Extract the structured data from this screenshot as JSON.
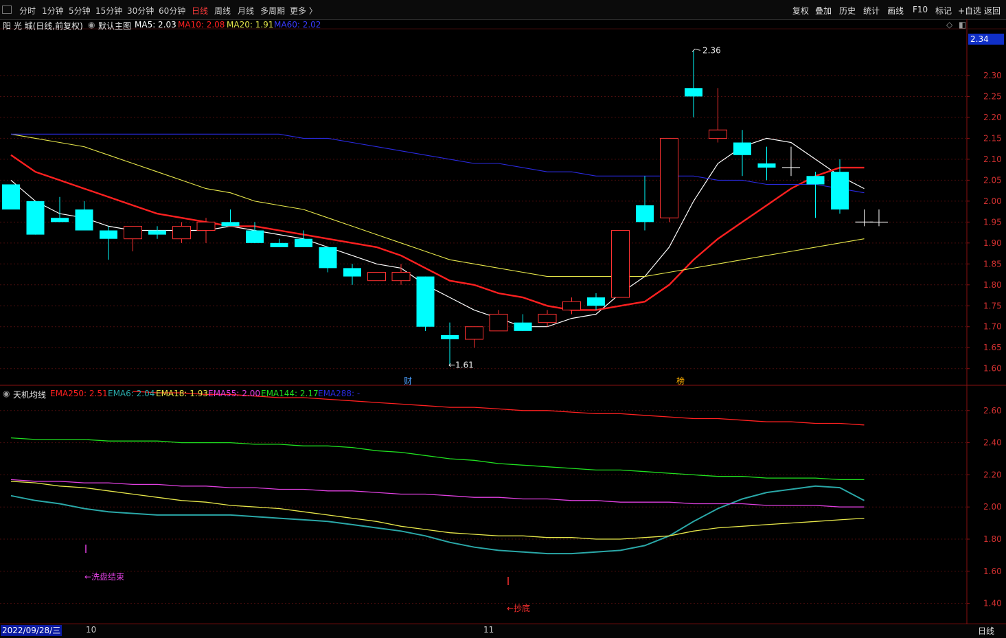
{
  "toolbar": {
    "periods": [
      "分时",
      "1分钟",
      "5分钟",
      "15分钟",
      "30分钟",
      "60分钟",
      "日线",
      "周线",
      "月线",
      "多周期",
      "更多 〉"
    ],
    "active_period": "日线",
    "tools": [
      "复权",
      "叠加",
      "历史",
      "统计",
      "画线",
      "F10",
      "标记",
      "+自选",
      "返回"
    ]
  },
  "main_header": {
    "stock": "阳 光 城(日线,前复权)",
    "indicator": "默认主图",
    "ma5": "MA5: 2.03",
    "ma10": "MA10: 2.08",
    "ma20": "MA20: 1.91",
    "ma60": "MA60: 2.02"
  },
  "sub_header": {
    "indicator": "天机均线",
    "ema250": "EMA250: 2.51",
    "ema6": "EMA6: 2.04",
    "ema18": "EMA18: 1.93",
    "ema55": "EMA55: 2.00",
    "ema144": "EMA144: 2.17",
    "ema288": "EMA288: -"
  },
  "colors": {
    "up": "#ff3232",
    "down": "#00ffff",
    "ma5": "#ffffff",
    "ma10": "#ff2020",
    "ma20": "#e6e64a",
    "ma60": "#2a2ae0",
    "ema250": "#ff2020",
    "ema6": "#2aa8a8",
    "ema18": "#e6e64a",
    "ema55": "#e040e0",
    "ema144": "#20e020"
  },
  "price_tag": "2.34",
  "high_label": "2.36",
  "low_label": "←1.61",
  "event_marks": [
    "财",
    "榜"
  ],
  "sub_annotations": [
    "←洗盘结束",
    "←抄底"
  ],
  "bottom": {
    "date": "2022/09/28/三",
    "x_labels": [
      "10",
      "11"
    ],
    "period": "日线"
  },
  "chart_data": [
    {
      "type": "candlestick",
      "title": "阳 光 城(日线,前复权)",
      "ylim": [
        1.57,
        2.4
      ],
      "y_ticks": [
        "2.30",
        "2.25",
        "2.20",
        "2.15",
        "2.10",
        "2.05",
        "2.00",
        "1.95",
        "1.90",
        "1.85",
        "1.80",
        "1.75",
        "1.70",
        "1.65",
        "1.60"
      ],
      "candles": [
        {
          "o": 2.04,
          "h": 2.04,
          "l": 1.98,
          "c": 1.98
        },
        {
          "o": 2.0,
          "h": 2.0,
          "l": 1.92,
          "c": 1.92
        },
        {
          "o": 1.96,
          "h": 2.01,
          "l": 1.95,
          "c": 1.95
        },
        {
          "o": 1.98,
          "h": 2.0,
          "l": 1.93,
          "c": 1.93
        },
        {
          "o": 1.93,
          "h": 1.94,
          "l": 1.86,
          "c": 1.91
        },
        {
          "o": 1.91,
          "h": 1.94,
          "l": 1.88,
          "c": 1.94
        },
        {
          "o": 1.93,
          "h": 1.94,
          "l": 1.91,
          "c": 1.92
        },
        {
          "o": 1.91,
          "h": 1.95,
          "l": 1.9,
          "c": 1.94
        },
        {
          "o": 1.93,
          "h": 1.96,
          "l": 1.9,
          "c": 1.95
        },
        {
          "o": 1.95,
          "h": 1.98,
          "l": 1.94,
          "c": 1.94
        },
        {
          "o": 1.93,
          "h": 1.95,
          "l": 1.9,
          "c": 1.9
        },
        {
          "o": 1.9,
          "h": 1.91,
          "l": 1.89,
          "c": 1.89
        },
        {
          "o": 1.91,
          "h": 1.93,
          "l": 1.89,
          "c": 1.89
        },
        {
          "o": 1.89,
          "h": 1.89,
          "l": 1.83,
          "c": 1.84
        },
        {
          "o": 1.84,
          "h": 1.85,
          "l": 1.8,
          "c": 1.82
        },
        {
          "o": 1.81,
          "h": 1.83,
          "l": 1.81,
          "c": 1.83
        },
        {
          "o": 1.81,
          "h": 1.85,
          "l": 1.8,
          "c": 1.83
        },
        {
          "o": 1.82,
          "h": 1.82,
          "l": 1.69,
          "c": 1.7
        },
        {
          "o": 1.68,
          "h": 1.71,
          "l": 1.61,
          "c": 1.67
        },
        {
          "o": 1.67,
          "h": 1.7,
          "l": 1.65,
          "c": 1.7
        },
        {
          "o": 1.69,
          "h": 1.74,
          "l": 1.69,
          "c": 1.73
        },
        {
          "o": 1.71,
          "h": 1.73,
          "l": 1.69,
          "c": 1.69
        },
        {
          "o": 1.71,
          "h": 1.74,
          "l": 1.7,
          "c": 1.73
        },
        {
          "o": 1.74,
          "h": 1.77,
          "l": 1.73,
          "c": 1.76
        },
        {
          "o": 1.77,
          "h": 1.78,
          "l": 1.74,
          "c": 1.75
        },
        {
          "o": 1.77,
          "h": 1.93,
          "l": 1.77,
          "c": 1.93
        },
        {
          "o": 1.99,
          "h": 2.06,
          "l": 1.93,
          "c": 1.95
        },
        {
          "o": 1.96,
          "h": 2.15,
          "l": 1.95,
          "c": 2.15
        },
        {
          "o": 2.27,
          "h": 2.36,
          "l": 2.2,
          "c": 2.25
        },
        {
          "o": 2.15,
          "h": 2.27,
          "l": 2.14,
          "c": 2.17
        },
        {
          "o": 2.14,
          "h": 2.17,
          "l": 2.06,
          "c": 2.11
        },
        {
          "o": 2.09,
          "h": 2.13,
          "l": 2.05,
          "c": 2.08
        },
        {
          "o": 2.08,
          "h": 2.13,
          "l": 2.06,
          "c": 2.08
        },
        {
          "o": 2.06,
          "h": 2.07,
          "l": 1.96,
          "c": 2.04
        },
        {
          "o": 2.07,
          "h": 2.1,
          "l": 1.97,
          "c": 1.98
        },
        {
          "o": 1.95,
          "h": 1.98,
          "l": 1.94,
          "c": 1.95
        }
      ],
      "series": [
        {
          "name": "MA5",
          "values": [
            2.05,
            2.0,
            1.97,
            1.96,
            1.94,
            1.93,
            1.93,
            1.93,
            1.93,
            1.94,
            1.93,
            1.92,
            1.91,
            1.89,
            1.87,
            1.85,
            1.84,
            1.8,
            1.77,
            1.74,
            1.72,
            1.7,
            1.7,
            1.72,
            1.73,
            1.78,
            1.82,
            1.89,
            2.0,
            2.09,
            2.13,
            2.15,
            2.14,
            2.1,
            2.06,
            2.03
          ]
        },
        {
          "name": "MA10",
          "values": [
            2.11,
            2.07,
            2.05,
            2.03,
            2.01,
            1.99,
            1.97,
            1.96,
            1.95,
            1.94,
            1.94,
            1.93,
            1.92,
            1.91,
            1.9,
            1.89,
            1.87,
            1.84,
            1.81,
            1.8,
            1.78,
            1.77,
            1.75,
            1.74,
            1.74,
            1.75,
            1.76,
            1.8,
            1.86,
            1.91,
            1.95,
            1.99,
            2.03,
            2.06,
            2.08,
            2.08
          ]
        },
        {
          "name": "MA20",
          "values": [
            2.16,
            2.15,
            2.14,
            2.13,
            2.11,
            2.09,
            2.07,
            2.05,
            2.03,
            2.02,
            2.0,
            1.99,
            1.98,
            1.96,
            1.94,
            1.92,
            1.9,
            1.88,
            1.86,
            1.85,
            1.84,
            1.83,
            1.82,
            1.82,
            1.82,
            1.82,
            1.82,
            1.83,
            1.84,
            1.85,
            1.86,
            1.87,
            1.88,
            1.89,
            1.9,
            1.91
          ]
        },
        {
          "name": "MA60",
          "values": [
            2.16,
            2.16,
            2.16,
            2.16,
            2.16,
            2.16,
            2.16,
            2.16,
            2.16,
            2.16,
            2.16,
            2.16,
            2.15,
            2.15,
            2.14,
            2.13,
            2.12,
            2.11,
            2.1,
            2.09,
            2.09,
            2.08,
            2.07,
            2.07,
            2.06,
            2.06,
            2.06,
            2.06,
            2.06,
            2.05,
            2.05,
            2.04,
            2.04,
            2.04,
            2.03,
            2.02
          ]
        }
      ]
    },
    {
      "type": "line",
      "title": "天机均线",
      "ylim": [
        1.36,
        2.74
      ],
      "y_ticks": [
        "2.60",
        "2.40",
        "2.20",
        "2.00",
        "1.80",
        "1.60",
        "1.40"
      ],
      "series": [
        {
          "name": "EMA250",
          "values": [
            null,
            null,
            null,
            null,
            null,
            2.72,
            2.71,
            2.71,
            2.7,
            2.7,
            2.69,
            2.68,
            2.68,
            2.67,
            2.66,
            2.65,
            2.64,
            2.63,
            2.62,
            2.62,
            2.61,
            2.6,
            2.6,
            2.59,
            2.58,
            2.58,
            2.57,
            2.56,
            2.55,
            2.55,
            2.54,
            2.53,
            2.53,
            2.52,
            2.52,
            2.51
          ]
        },
        {
          "name": "EMA6",
          "values": [
            2.07,
            2.04,
            2.02,
            1.99,
            1.97,
            1.96,
            1.95,
            1.95,
            1.95,
            1.95,
            1.94,
            1.93,
            1.92,
            1.91,
            1.89,
            1.87,
            1.85,
            1.82,
            1.78,
            1.75,
            1.73,
            1.72,
            1.71,
            1.71,
            1.72,
            1.73,
            1.76,
            1.82,
            1.91,
            1.99,
            2.05,
            2.09,
            2.11,
            2.13,
            2.12,
            2.04
          ]
        },
        {
          "name": "EMA18",
          "values": [
            2.16,
            2.15,
            2.13,
            2.12,
            2.1,
            2.08,
            2.06,
            2.04,
            2.03,
            2.01,
            2.0,
            1.99,
            1.97,
            1.95,
            1.93,
            1.91,
            1.88,
            1.86,
            1.84,
            1.83,
            1.82,
            1.82,
            1.81,
            1.81,
            1.8,
            1.8,
            1.81,
            1.82,
            1.85,
            1.87,
            1.88,
            1.89,
            1.9,
            1.91,
            1.92,
            1.93
          ]
        },
        {
          "name": "EMA55",
          "values": [
            2.17,
            2.16,
            2.16,
            2.15,
            2.15,
            2.14,
            2.14,
            2.13,
            2.13,
            2.12,
            2.12,
            2.11,
            2.11,
            2.1,
            2.1,
            2.09,
            2.08,
            2.08,
            2.07,
            2.06,
            2.06,
            2.05,
            2.05,
            2.04,
            2.04,
            2.03,
            2.03,
            2.03,
            2.02,
            2.02,
            2.02,
            2.01,
            2.01,
            2.01,
            2.0,
            2.0
          ]
        },
        {
          "name": "EMA144",
          "values": [
            2.43,
            2.42,
            2.42,
            2.42,
            2.41,
            2.41,
            2.41,
            2.4,
            2.4,
            2.4,
            2.39,
            2.39,
            2.38,
            2.38,
            2.37,
            2.35,
            2.34,
            2.32,
            2.3,
            2.29,
            2.27,
            2.26,
            2.25,
            2.24,
            2.23,
            2.23,
            2.22,
            2.21,
            2.2,
            2.19,
            2.19,
            2.18,
            2.18,
            2.18,
            2.17,
            2.17
          ]
        }
      ]
    }
  ]
}
